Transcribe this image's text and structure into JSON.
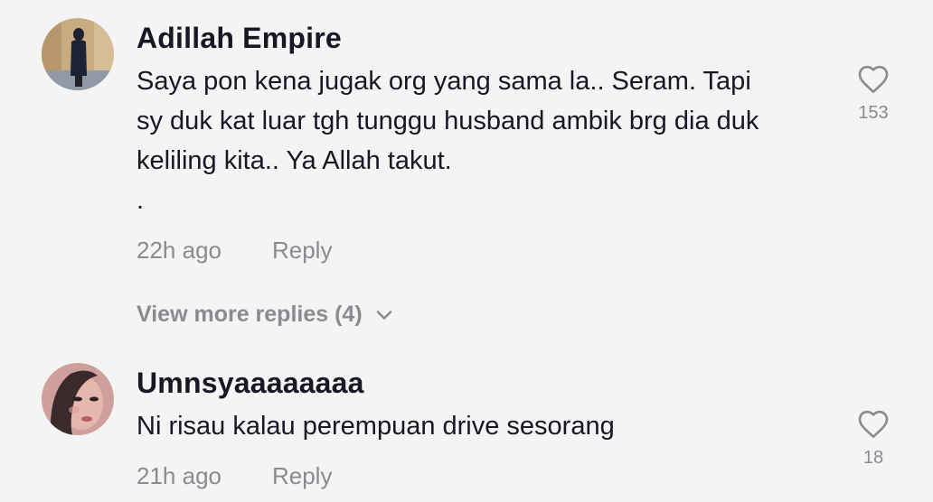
{
  "comments": [
    {
      "username": "Adillah Empire",
      "text": "Saya pon kena jugak org yang sama la.. Seram. Tapi\nsy duk kat luar tgh tunggu husband ambik brg dia duk\nkeliling kita.. Ya Allah takut.\n.",
      "time": "22h ago",
      "reply_label": "Reply",
      "likes": "153",
      "avatar_icon": "user-photo-avatar"
    },
    {
      "username": "Umnsyaaaaaaaa",
      "text": "Ni risau kalau perempuan drive sesorang",
      "time": "21h ago",
      "reply_label": "Reply",
      "likes": "18",
      "avatar_icon": "user-photo-avatar"
    }
  ],
  "view_more": {
    "label": "View more replies (4)",
    "icon": "chevron-down-icon"
  },
  "colors": {
    "background": "#f4f4f4",
    "text_primary": "#161823",
    "text_secondary": "#8a8b91"
  }
}
